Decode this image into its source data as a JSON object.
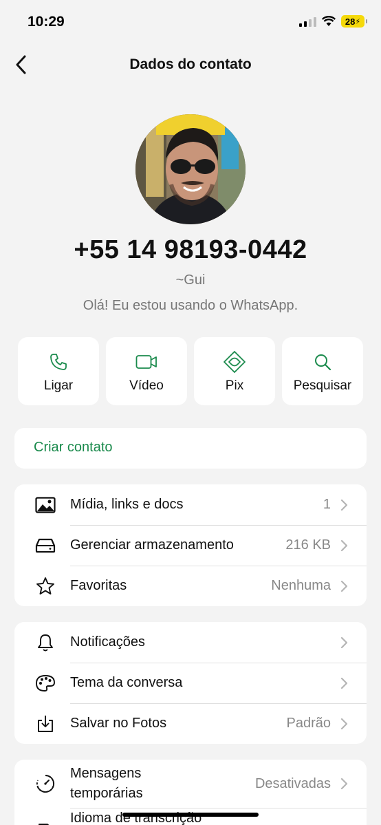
{
  "status": {
    "time": "10:29",
    "battery": "28"
  },
  "header": {
    "title": "Dados do contato",
    "back_icon": "chevron-left-icon"
  },
  "profile": {
    "phone": "+55 14 98193-0442",
    "nickname": "~Gui",
    "about": "Olá! Eu estou usando o WhatsApp."
  },
  "actions": [
    {
      "label": "Ligar",
      "icon": "phone-icon"
    },
    {
      "label": "Vídeo",
      "icon": "video-icon"
    },
    {
      "label": "Pix",
      "icon": "pix-icon"
    },
    {
      "label": "Pesquisar",
      "icon": "search-icon"
    }
  ],
  "create_contact": {
    "label": "Criar contato"
  },
  "media_section": [
    {
      "label": "Mídia, links e docs",
      "value": "1",
      "icon": "image-icon"
    },
    {
      "label": "Gerenciar armazenamento",
      "value": "216 KB",
      "icon": "storage-icon"
    },
    {
      "label": "Favoritas",
      "value": "Nenhuma",
      "icon": "star-icon"
    }
  ],
  "prefs_section": [
    {
      "label": "Notificações",
      "value": "",
      "icon": "bell-icon"
    },
    {
      "label": "Tema da conversa",
      "value": "",
      "icon": "palette-icon"
    },
    {
      "label": "Salvar no Fotos",
      "value": "Padrão",
      "icon": "save-download-icon"
    }
  ],
  "more_section": [
    {
      "label_line1": "Mensagens",
      "label_line2": "temporárias",
      "value": "Desativadas",
      "icon": "timer-icon"
    },
    {
      "label": "Idioma de transcrição",
      "icon": "language-icon"
    }
  ],
  "colors": {
    "accent": "#1a8a4c",
    "background": "#f3f3f3",
    "card": "#ffffff",
    "battery": "#f5d90a"
  }
}
